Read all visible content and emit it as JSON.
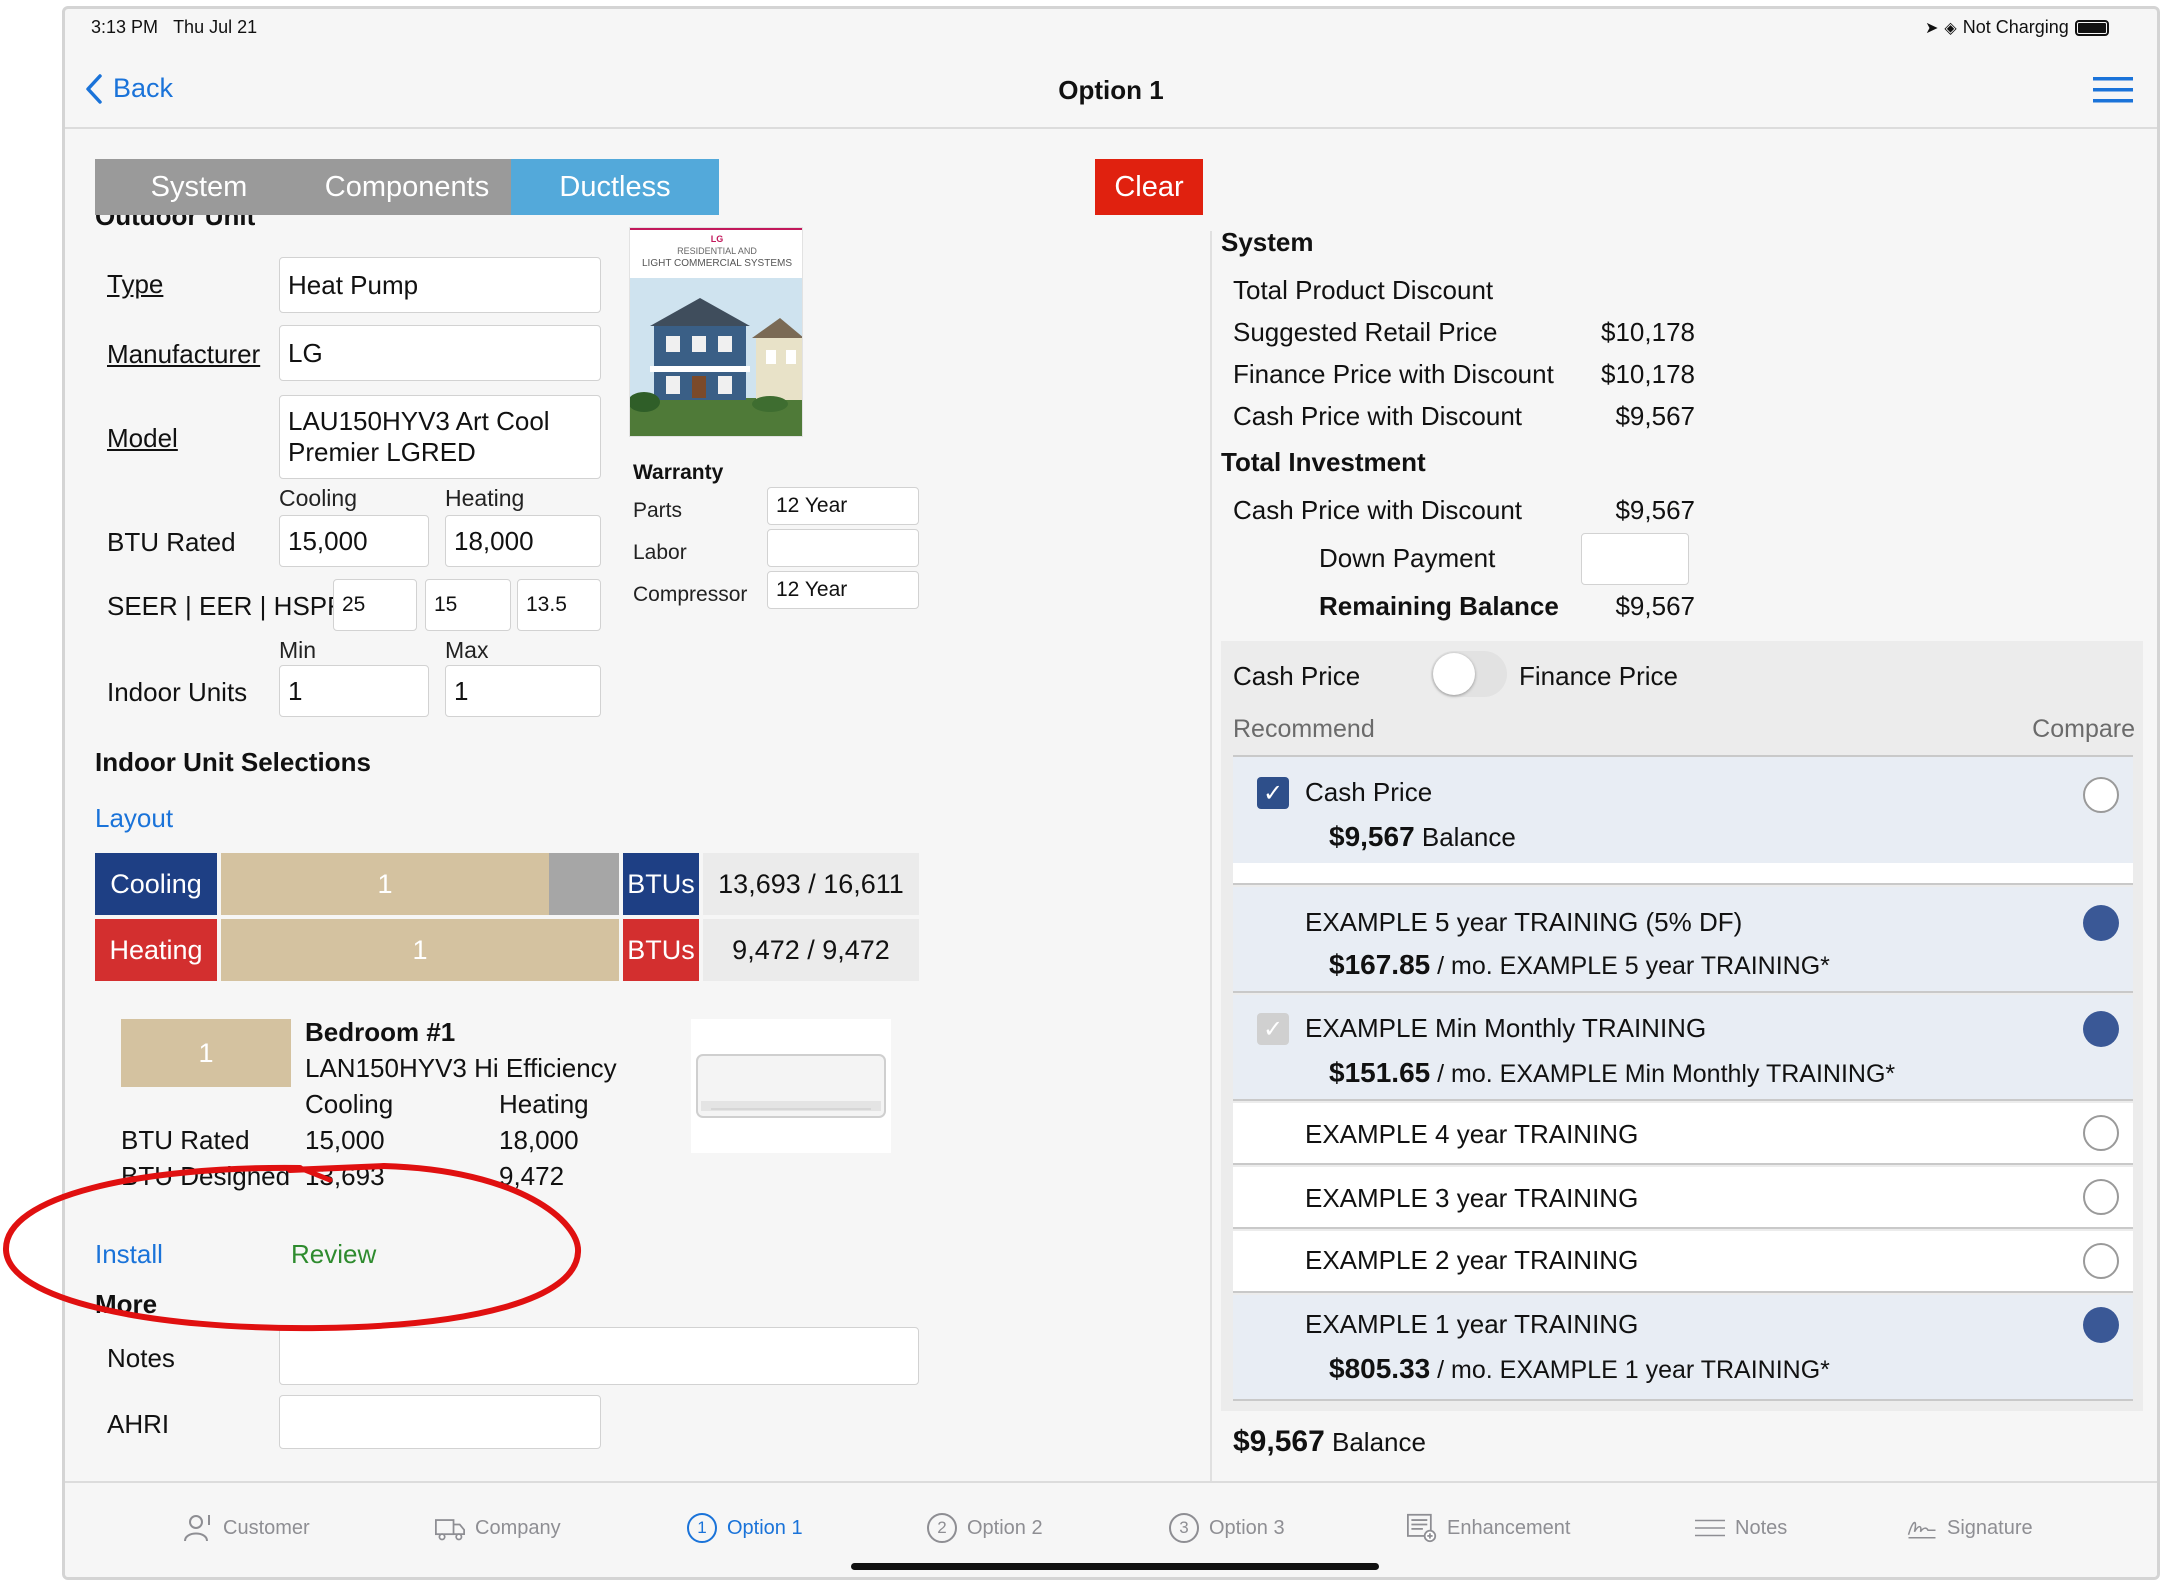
{
  "status_bar": {
    "time": "3:13 PM",
    "date": "Thu Jul 21",
    "battery": "Not Charging"
  },
  "nav": {
    "back_label": "Back",
    "title": "Option 1"
  },
  "segments": [
    "System",
    "Components",
    "Ductless"
  ],
  "clear_label": "Clear",
  "outdoor": {
    "section_title": "Outdoor Unit",
    "type_label": "Type",
    "type_value": "Heat Pump",
    "manufacturer_label": "Manufacturer",
    "manufacturer_value": "LG",
    "model_label": "Model",
    "model_value_line1": "LAU150HYV3 Art Cool",
    "model_value_line2": "Premier LGRED",
    "cooling_label": "Cooling",
    "heating_label": "Heating",
    "btu_rated_label": "BTU Rated",
    "btu_cooling": "15,000",
    "btu_heating": "18,000",
    "seer_label": "SEER | EER | HSPF",
    "seer": "25",
    "eer": "15",
    "hspf": "13.5",
    "min_label": "Min",
    "max_label": "Max",
    "indoor_units_label": "Indoor Units",
    "indoor_min": "1",
    "indoor_max": "1"
  },
  "brochure": {
    "line1": "RESIDENTIAL AND",
    "line2": "LIGHT COMMERCIAL SYSTEMS",
    "brand": "LG"
  },
  "warranty": {
    "title": "Warranty",
    "parts_label": "Parts",
    "parts_value": "12 Year",
    "labor_label": "Labor",
    "labor_value": "",
    "compressor_label": "Compressor",
    "compressor_value": "12 Year"
  },
  "indoor_selections": {
    "title": "Indoor Unit Selections",
    "layout_link": "Layout",
    "cooling_label": "Cooling",
    "cooling_count": "1",
    "cooling_btus_label": "BTUs",
    "cooling_btus": "13,693 / 16,611",
    "heating_label": "Heating",
    "heating_count": "1",
    "heating_btus_label": "BTUs",
    "heating_btus": "9,472 / 9,472"
  },
  "bedroom": {
    "badge": "1",
    "name": "Bedroom #1",
    "model": "LAN150HYV3 Hi Efficiency",
    "cooling_label": "Cooling",
    "heating_label": "Heating",
    "btu_rated_label": "BTU Rated",
    "rated_cooling": "15,000",
    "rated_heating": "18,000",
    "btu_designed_label": "BTU Designed",
    "designed_cooling": "13,693",
    "designed_heating": "9,472"
  },
  "links": {
    "install": "Install",
    "review": "Review"
  },
  "more": {
    "title": "More",
    "notes_label": "Notes",
    "notes_value": "",
    "ahri_label": "AHRI",
    "ahri_value": ""
  },
  "summary": {
    "system_title": "System",
    "total_product_discount_label": "Total Product Discount",
    "suggested_retail_label": "Suggested Retail Price",
    "suggested_retail": "$10,178",
    "finance_price_label": "Finance Price with Discount",
    "finance_price": "$10,178",
    "cash_price_label": "Cash Price with Discount",
    "cash_price": "$9,567",
    "total_investment_title": "Total Investment",
    "ti_cash_label": "Cash Price with Discount",
    "ti_cash": "$9,567",
    "down_payment_label": "Down Payment",
    "down_payment": "",
    "remaining_label": "Remaining Balance",
    "remaining": "$9,567"
  },
  "pricing_toggle": {
    "left": "Cash Price",
    "right": "Finance Price"
  },
  "options_header": {
    "recommend": "Recommend",
    "compare": "Compare"
  },
  "options": [
    {
      "title": "Cash Price",
      "amount": "$9,567",
      "suffix": " Balance"
    },
    {
      "title": "EXAMPLE 5 year TRAINING (5% DF)",
      "amount": "$167.85",
      "suffix": " / mo. EXAMPLE 5 year TRAINING*"
    },
    {
      "title": "EXAMPLE Min Monthly TRAINING",
      "amount": "$151.65",
      "suffix": " / mo. EXAMPLE Min Monthly TRAINING*"
    },
    {
      "title": "EXAMPLE 4 year TRAINING"
    },
    {
      "title": "EXAMPLE 3 year TRAINING"
    },
    {
      "title": "EXAMPLE 2 year TRAINING"
    },
    {
      "title": "EXAMPLE 1 year TRAINING",
      "amount": "$805.33",
      "suffix": " / mo. EXAMPLE 1 year TRAINING*"
    }
  ],
  "footer_balance": {
    "amount": "$9,567",
    "suffix": " Balance"
  },
  "tabs": [
    "Customer",
    "Company",
    "Option 1",
    "Option 2",
    "Option 3",
    "Enhancement",
    "Notes",
    "Signature"
  ],
  "tab_numbers": [
    "1",
    "2",
    "3"
  ],
  "colors": {
    "accent": "#1a73d9",
    "navy": "#1e3f84",
    "red": "#d32f2f",
    "tan": "#d4c2a0",
    "seg_active": "#53a9da",
    "seg_inactive": "#9a9a9a",
    "clear": "#e0210f"
  }
}
